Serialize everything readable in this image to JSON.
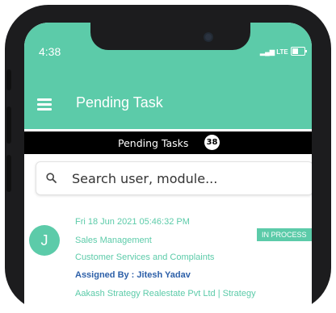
{
  "status_bar": {
    "time": "4:38",
    "network": "LTE",
    "battery_level": 0.5
  },
  "app_bar": {
    "menu_icon": "hamburger-menu-icon",
    "title": "Pending Task"
  },
  "pending_header": {
    "label": "Pending Tasks",
    "count": "38"
  },
  "search": {
    "icon": "search-icon",
    "placeholder": "Search user, module..."
  },
  "tasks": [
    {
      "avatar_initial": "J",
      "datetime": "Fri 18 Jun 2021 05:46:32 PM",
      "module": "Sales Management",
      "subject": "Customer Services and Complaints",
      "assigned_by": "Assigned By : Jitesh Yadav",
      "organization": "Aakash Strategy Realestate Pvt Ltd | Strategy",
      "status": "IN PROCESS"
    }
  ],
  "colors": {
    "accent": "#5ccba9",
    "assigned_text": "#2c5fa8",
    "header_bar": "#000000"
  }
}
